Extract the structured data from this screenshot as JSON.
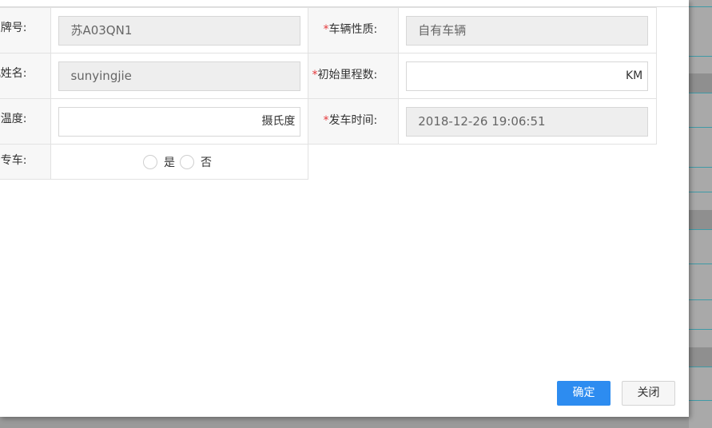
{
  "form": {
    "plate_label": "车牌号:",
    "plate_value": "苏A03QN1",
    "nature_label": "车辆性质:",
    "nature_value": "自有车辆",
    "driver_label": "司机姓名:",
    "driver_value": "sunyingjie",
    "mileage_label": "初始里程数:",
    "mileage_value": "",
    "mileage_unit": "KM",
    "temp_label": "发车温度:",
    "temp_value": "",
    "temp_unit": "摄氏度",
    "depart_label": "发车时间:",
    "depart_value": "2018-12-26 19:06:51",
    "dedicated_label": "是否专车:",
    "dedicated_yes": "是",
    "dedicated_no": "否",
    "required_mark": "*"
  },
  "buttons": {
    "ok": "确定",
    "close": "关闭"
  },
  "colors": {
    "primary": "#2d8cf0",
    "required": "#e4393c"
  }
}
